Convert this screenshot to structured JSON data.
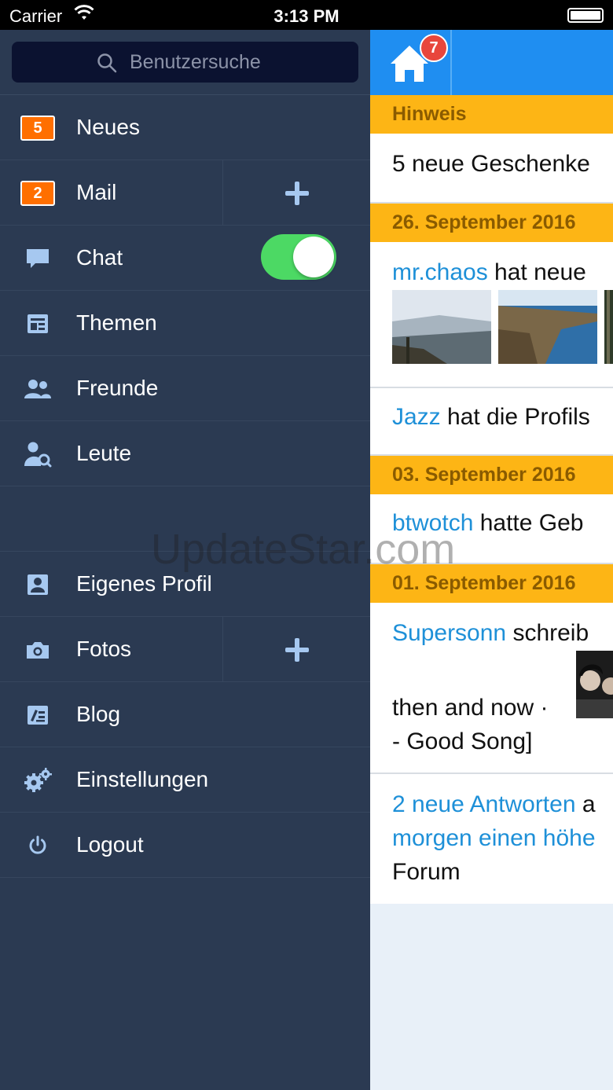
{
  "status_bar": {
    "carrier": "Carrier",
    "time": "3:13 PM"
  },
  "sidebar": {
    "search_placeholder": "Benutzersuche",
    "items": [
      {
        "label": "Neues",
        "badge": "5"
      },
      {
        "label": "Mail",
        "badge": "2"
      },
      {
        "label": "Chat",
        "toggle_on": true
      },
      {
        "label": "Themen"
      },
      {
        "label": "Freunde"
      },
      {
        "label": "Leute"
      },
      {
        "label": "Eigenes Profil"
      },
      {
        "label": "Fotos"
      },
      {
        "label": "Blog"
      },
      {
        "label": "Einstellungen"
      },
      {
        "label": "Logout"
      }
    ]
  },
  "main": {
    "home_notification_count": "7",
    "sections": {
      "notice": "Hinweis",
      "date1": "26. September 2016",
      "date2": "03. September 2016",
      "date3": "01. September 2016"
    },
    "feed": {
      "notice_text": "5 neue Geschenke",
      "f1_user": "mr.chaos",
      "f1_text": " hat neue",
      "f2_user": "Jazz",
      "f2_text": " hat die Profils",
      "f3_user": "btwotch",
      "f3_text": " hatte Geb",
      "f4_user": "Supersonn",
      "f4_text": " schreib",
      "f4_line2": "then and now ·",
      "f4_line3": "- Good Song]",
      "f5_link1": "2 neue Antworten",
      "f5_text1": " a",
      "f5_link2": "morgen einen höhe",
      "f5_line3": "Forum"
    }
  },
  "watermark": "UpdateStar.com",
  "colors": {
    "sidebar_bg": "#2b3a52",
    "topbar_blue": "#1f8ef1",
    "section_orange": "#fdb515",
    "badge_orange": "#ff6f00",
    "link_blue": "#1e90d8",
    "toggle_green": "#4cd964",
    "icon_blue": "#a6c8f0"
  }
}
